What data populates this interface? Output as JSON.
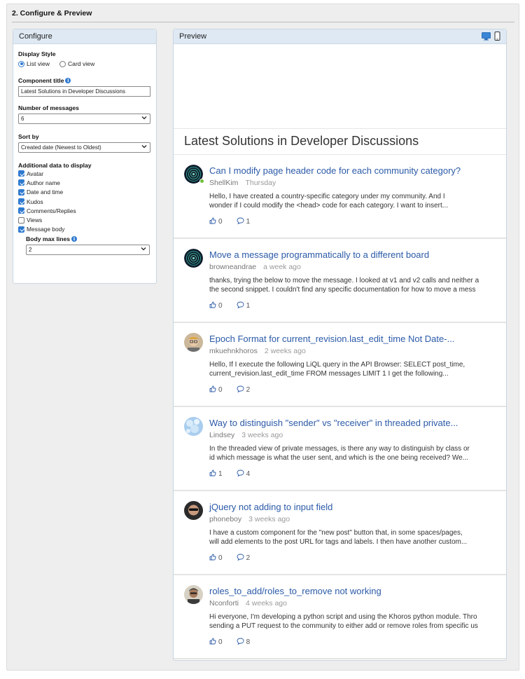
{
  "section": {
    "title": "2. Configure & Preview"
  },
  "configure": {
    "header": "Configure",
    "display_style": {
      "label": "Display Style",
      "options": [
        "List view",
        "Card view"
      ],
      "selected": "List view"
    },
    "component_title": {
      "label": "Component title",
      "value": "Latest Solutions in Developer Discussions"
    },
    "number_of_messages": {
      "label": "Number of messages",
      "value": "6"
    },
    "sort_by": {
      "label": "Sort by",
      "value": "Created date (Newest to Oldest)"
    },
    "additional": {
      "label": "Additional data to display",
      "items": [
        {
          "label": "Avatar",
          "checked": true
        },
        {
          "label": "Author name",
          "checked": true
        },
        {
          "label": "Date and time",
          "checked": true
        },
        {
          "label": "Kudos",
          "checked": true
        },
        {
          "label": "Comments/Replies",
          "checked": true
        },
        {
          "label": "Views",
          "checked": false
        },
        {
          "label": "Message body",
          "checked": true
        }
      ]
    },
    "body_max_lines": {
      "label": "Body max lines",
      "value": "2"
    }
  },
  "preview": {
    "header": "Preview",
    "widget_title": "Latest Solutions in Developer Discussions",
    "messages": [
      {
        "subject": "Can I modify page header code for each community category?",
        "author": "ShellKim",
        "time": "Thursday",
        "body": [
          "Hello, I have created a country-specific category under my community. And I",
          "wonder if I could modify the <head> code for each category. I want to insert..."
        ],
        "kudos": "0",
        "replies": "1"
      },
      {
        "subject": "Move a message programmatically to a different board",
        "author": "browneandrae",
        "time": "a week ago",
        "body": [
          "thanks, trying the below to move the message. I looked at v1 and v2 calls and neither a",
          "the second snippet. I couldn't find any specific documentation for how to move a mess"
        ],
        "kudos": "0",
        "replies": "1"
      },
      {
        "subject": "Epoch Format for current_revision.last_edit_time Not Date-...",
        "author": "mkuehnkhoros",
        "time": "2 weeks ago",
        "body": [
          "Hello, If I execute the following LiQL query in the API Browser:   SELECT post_time,",
          "current_revision.last_edit_time FROM messages LIMIT 1   I get the following..."
        ],
        "kudos": "0",
        "replies": "2"
      },
      {
        "subject": "Way to distinguish \"sender\" vs \"receiver\" in threaded private...",
        "author": "Lindsey",
        "time": "3 weeks ago",
        "body": [
          "In the threaded view of private messages, is there any way to distinguish by class or",
          "id which message is what the user sent, and which is the one being received? We..."
        ],
        "kudos": "1",
        "replies": "4"
      },
      {
        "subject": "jQuery not adding to input field",
        "author": "phoneboy",
        "time": "3 weeks ago",
        "body": [
          "I have a custom component for the \"new post\" button that, in some spaces/pages,",
          "will add elements to the post URL for tags and labels. I then have another custom..."
        ],
        "kudos": "0",
        "replies": "2"
      },
      {
        "subject": "roles_to_add/roles_to_remove not working",
        "author": "Nconforti",
        "time": "4 weeks ago",
        "body": [
          "Hi everyone, I'm developing a python script and using the Khoros python module. Thro",
          "sending a PUT request to the community to either add or remove roles from specific us"
        ],
        "kudos": "0",
        "replies": "8"
      }
    ]
  }
}
